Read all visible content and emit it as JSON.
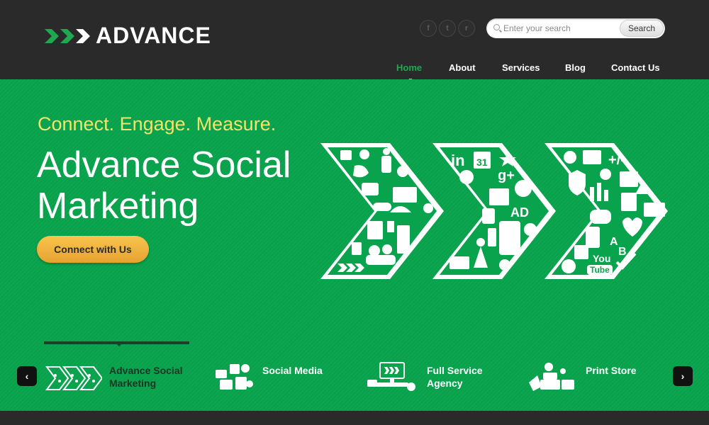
{
  "brand": {
    "name": "ADVANCE",
    "colors": {
      "green": "#08a34c",
      "dark": "#2a2a2a",
      "yellow": "#f2e46a",
      "orange": "#f0b03f"
    }
  },
  "header": {
    "social_icons": [
      "facebook-icon",
      "twitter-icon",
      "rss-icon"
    ],
    "social_glyphs": [
      "f",
      "t",
      "r"
    ],
    "search": {
      "placeholder": "Enter your search",
      "button_label": "Search"
    }
  },
  "nav": {
    "items": [
      {
        "label": "Home",
        "active": true
      },
      {
        "label": "About",
        "active": false
      },
      {
        "label": "Services",
        "active": false
      },
      {
        "label": "Blog",
        "active": false
      },
      {
        "label": "Contact Us",
        "active": false
      }
    ]
  },
  "hero": {
    "tagline": "Connect. Engage. Measure.",
    "headline": "Advance Social Marketing",
    "cta_label": "Connect with Us",
    "graphic_labels": {
      "in": "in",
      "cal": "31",
      "g": "g+",
      "ad": "AD",
      "you": "You",
      "tube": "Tube",
      "a": "A",
      "b": "B"
    }
  },
  "services": {
    "prev_glyph": "‹",
    "next_glyph": "›",
    "items": [
      {
        "label": "Advance Social Marketing",
        "selected": true
      },
      {
        "label": "Social Media",
        "selected": false
      },
      {
        "label": "Full Service Agency",
        "selected": false
      },
      {
        "label": "Print Store",
        "selected": false
      }
    ]
  }
}
